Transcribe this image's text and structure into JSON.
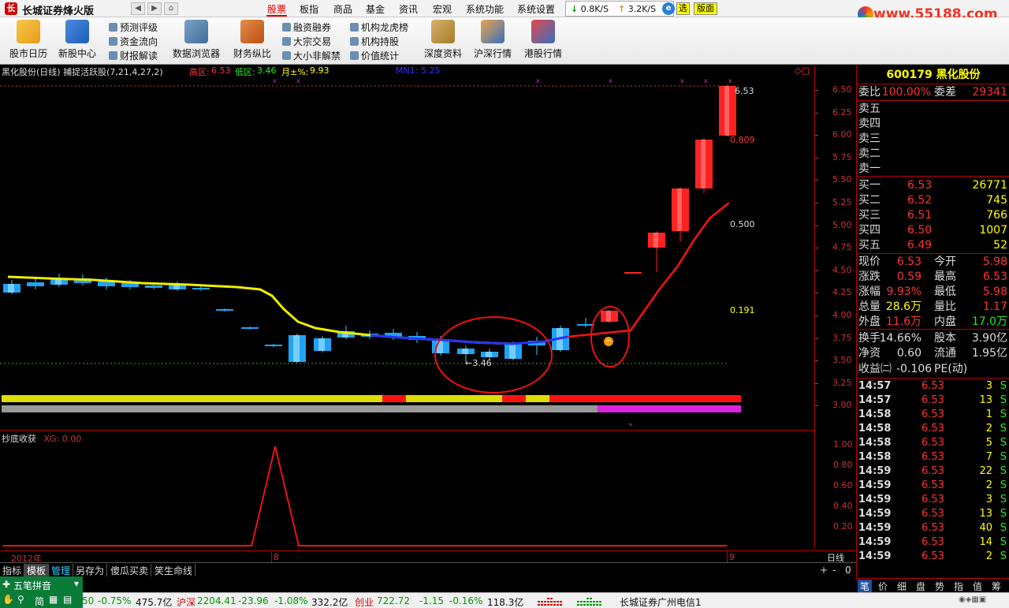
{
  "app": {
    "title": "长城证券烽火版",
    "logo": "长",
    "brand_url": "www.55188.com",
    "nav_back": "◀",
    "nav_fwd": "▶",
    "nav_home": "⌂"
  },
  "top_menu": [
    "股票",
    "板指",
    "商品",
    "基金",
    "资讯",
    "宏观",
    "系统功能",
    "系统设置"
  ],
  "speed": {
    "down": "0.8K/S",
    "up": "3.2K/S"
  },
  "top_buttons": {
    "select": "选",
    "layout": "版面"
  },
  "toolbar": {
    "big": [
      "股市日历",
      "新股中心",
      "数据浏览器",
      "财务纵比",
      "深度资料",
      "沪深行情",
      "港股行情"
    ],
    "small_col1": [
      "预测评级",
      "资金流向",
      "财报解读"
    ],
    "small_col2": [
      "融资融券",
      "大宗交易",
      "大小非解禁"
    ],
    "small_col3": [
      "机构龙虎榜",
      "机构持股",
      "价值统计"
    ]
  },
  "chart_header": {
    "name": "黑化股份(日线) 捕捉活跃股(7,21,4,27,2)",
    "high_label": "高区:",
    "high_value": "6.53",
    "low_label": "低区:",
    "low_value": "3.46",
    "month_label": "月±%:",
    "month_value": "9.93",
    "mn_label": "MN1:",
    "mn_value": "5.25",
    "corner": "◇□"
  },
  "chart_labels": {
    "price_high": "6.53",
    "price_low": "3.46",
    "fib_809": "0.809",
    "fib_500": "0.500",
    "fib_191": "0.191"
  },
  "price_axis": [
    "6.50",
    "6.25",
    "6.00",
    "5.75",
    "5.50",
    "5.25",
    "5.00",
    "4.75",
    "4.50",
    "4.25",
    "4.00",
    "3.75",
    "3.50",
    "3.25",
    "3.00"
  ],
  "sub_chart": {
    "title": "抄底收获",
    "indicator": "XG: 0.00",
    "axis": [
      "1.00",
      "0.80",
      "0.60",
      "0.40",
      "0.20"
    ]
  },
  "time_axis": {
    "year": "2012年",
    "m8": "8",
    "m9": "9",
    "period": "日线"
  },
  "quote": {
    "code": "600179",
    "name": "黑化股份",
    "wb_label": "委比",
    "wb_value": "100.00%",
    "wc_label": "委差",
    "wc_value": "29341",
    "sell": [
      "卖五",
      "卖四",
      "卖三",
      "卖二",
      "卖一"
    ],
    "buy": [
      {
        "label": "买一",
        "price": "6.53",
        "vol": "26771"
      },
      {
        "label": "买二",
        "price": "6.52",
        "vol": "745"
      },
      {
        "label": "买三",
        "price": "6.51",
        "vol": "766"
      },
      {
        "label": "买四",
        "price": "6.50",
        "vol": "1007"
      },
      {
        "label": "买五",
        "price": "6.49",
        "vol": "52"
      }
    ],
    "stats": [
      {
        "l1": "现价",
        "v1": "6.53",
        "c1": "red",
        "l2": "今开",
        "v2": "5.98",
        "c2": "red"
      },
      {
        "l1": "涨跌",
        "v1": "0.59",
        "c1": "red",
        "l2": "最高",
        "v2": "6.53",
        "c2": "red"
      },
      {
        "l1": "涨幅",
        "v1": "9.93%",
        "c1": "red",
        "l2": "最低",
        "v2": "5.98",
        "c2": "red"
      },
      {
        "l1": "总量",
        "v1": "28.6万",
        "c1": "yellow",
        "l2": "量比",
        "v2": "1.17",
        "c2": "red"
      },
      {
        "l1": "外盘",
        "v1": "11.6万",
        "c1": "red",
        "l2": "内盘",
        "v2": "17.0万",
        "c2": "green"
      }
    ],
    "stats2": [
      {
        "l1": "换手",
        "v1": "14.66%",
        "l2": "股本",
        "v2": "3.90亿"
      },
      {
        "l1": "净资",
        "v1": "0.60",
        "l2": "流通",
        "v2": "1.95亿"
      }
    ],
    "pe_label": "收益㈡",
    "pe_value": "-0.106",
    "pe_label2": "PE(动)",
    "trades": [
      {
        "time": "14:57",
        "price": "6.53",
        "vol": "3",
        "side": "S"
      },
      {
        "time": "14:57",
        "price": "6.53",
        "vol": "13",
        "side": "S"
      },
      {
        "time": "14:58",
        "price": "6.53",
        "vol": "1",
        "side": "S"
      },
      {
        "time": "14:58",
        "price": "6.53",
        "vol": "2",
        "side": "S"
      },
      {
        "time": "14:58",
        "price": "6.53",
        "vol": "5",
        "side": "S"
      },
      {
        "time": "14:58",
        "price": "6.53",
        "vol": "7",
        "side": "S"
      },
      {
        "time": "14:59",
        "price": "6.53",
        "vol": "22",
        "side": "S"
      },
      {
        "time": "14:59",
        "price": "6.53",
        "vol": "2",
        "side": "S"
      },
      {
        "time": "14:59",
        "price": "6.53",
        "vol": "3",
        "side": "S"
      },
      {
        "time": "14:59",
        "price": "6.53",
        "vol": "13",
        "side": "S"
      },
      {
        "time": "14:59",
        "price": "6.53",
        "vol": "40",
        "side": "S"
      },
      {
        "time": "14:59",
        "price": "6.53",
        "vol": "14",
        "side": "S"
      },
      {
        "time": "14:59",
        "price": "6.53",
        "vol": "2",
        "side": "S"
      }
    ],
    "tabs": [
      "笔",
      "价",
      "细",
      "盘",
      "势",
      "指",
      "值",
      "筹"
    ]
  },
  "bottom_tabs": [
    "指标",
    "模板",
    "管理",
    "另存为",
    "傻瓜买卖",
    "笑生命线"
  ],
  "zoom": {
    "plus": "+",
    "minus": "-",
    "zero": "0"
  },
  "ime": {
    "name": "五笔拼音",
    "mode": "简"
  },
  "status": {
    "idx1_val": "50",
    "idx1_pct": "-0.75%",
    "idx1_amt": "475.7亿",
    "idx2_name": "沪深",
    "idx2_val": "2204.41",
    "idx2_chg": "-23.96",
    "idx2_pct": "-1.08%",
    "idx2_amt": "332.2亿",
    "idx3_name": "创业",
    "idx3_val": "722.72",
    "idx3_chg": "-1.15",
    "idx3_pct": "-0.16%",
    "idx3_amt": "118.3亿",
    "server": "长城证券广州电信1"
  }
}
